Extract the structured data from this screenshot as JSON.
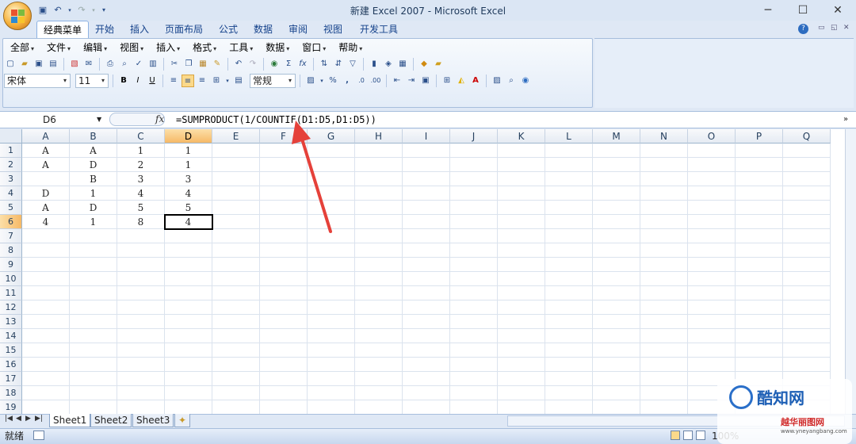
{
  "window": {
    "title": "新建 Excel 2007 - Microsoft Excel",
    "minimize": "─",
    "maximize": "☐",
    "close": "✕"
  },
  "tabs": [
    "经典菜单",
    "开始",
    "插入",
    "页面布局",
    "公式",
    "数据",
    "审阅",
    "视图",
    "开发工具"
  ],
  "menus": [
    "全部",
    "文件",
    "编辑",
    "视图",
    "插入",
    "格式",
    "工具",
    "数据",
    "窗口",
    "帮助"
  ],
  "format": {
    "font": "宋体",
    "size": "11",
    "number_format": "常规",
    "bold": "B",
    "italic": "I",
    "underline": "U",
    "percent": "%",
    "comma": ",",
    "sigma": "Σ",
    "fx": "fx"
  },
  "formula_bar": {
    "cell_ref": "D6",
    "fx_label": "fx",
    "formula": "=SUMPRODUCT(1/COUNTIF(D1:D5,D1:D5))",
    "expand": "»"
  },
  "columns": [
    "A",
    "B",
    "C",
    "D",
    "E",
    "F",
    "G",
    "H",
    "I",
    "J",
    "K",
    "L",
    "M",
    "N",
    "O",
    "P",
    "Q"
  ],
  "selected_col": "D",
  "rows": [
    "1",
    "2",
    "3",
    "4",
    "5",
    "6",
    "7",
    "8",
    "9",
    "10",
    "11",
    "12",
    "13",
    "14",
    "15",
    "16",
    "17",
    "18",
    "19"
  ],
  "selected_row": "6",
  "cells": [
    [
      "A",
      "A",
      "1",
      "1"
    ],
    [
      "A",
      "D",
      "2",
      "1"
    ],
    [
      "",
      "B",
      "3",
      "3"
    ],
    [
      "D",
      "1",
      "4",
      "4"
    ],
    [
      "A",
      "D",
      "5",
      "5"
    ],
    [
      "4",
      "1",
      "8",
      "4"
    ]
  ],
  "sheets": [
    "Sheet1",
    "Sheet2",
    "Sheet3"
  ],
  "active_sheet": "Sheet1",
  "status": {
    "ready": "就绪",
    "zoom": "100%"
  },
  "watermark": {
    "brand": "酷知网",
    "sub": "越华丽图网",
    "url": "www.yneyangbang.com"
  },
  "colors": {
    "selection_header": "#f6b967",
    "ribbon_border": "#a7bedd",
    "arrow": "#e5413a"
  }
}
